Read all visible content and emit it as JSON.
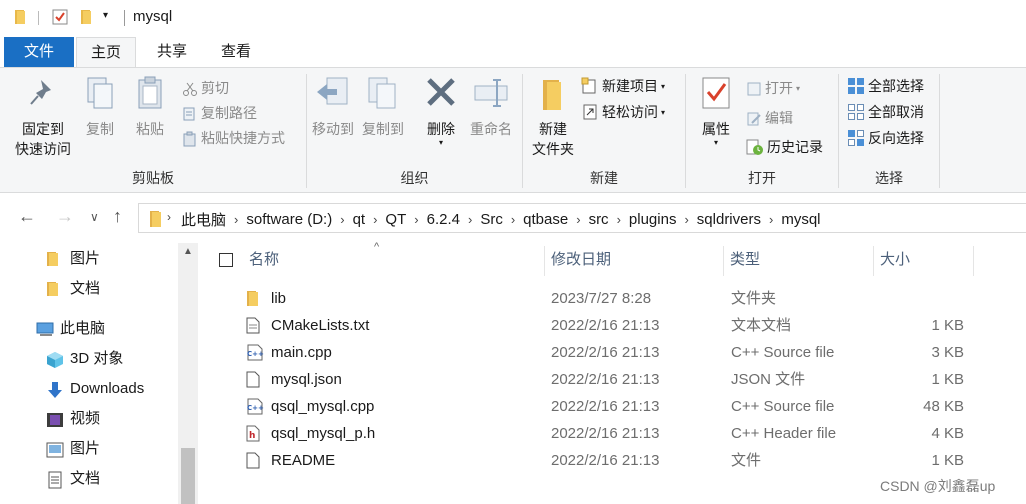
{
  "window": {
    "title": "mysql"
  },
  "tabs": {
    "file": "文件",
    "home": "主页",
    "share": "共享",
    "view": "查看"
  },
  "ribbon": {
    "clipboard": {
      "label": "剪贴板",
      "pin_line1": "固定到",
      "pin_line2": "快速访问",
      "copy": "复制",
      "paste": "粘贴",
      "cut": "剪切",
      "copy_path": "复制路径",
      "paste_shortcut": "粘贴快捷方式"
    },
    "organize": {
      "label": "组织",
      "move_to": "移动到",
      "copy_to": "复制到",
      "delete": "删除",
      "rename": "重命名"
    },
    "new": {
      "label": "新建",
      "new_folder_line1": "新建",
      "new_folder_line2": "文件夹",
      "new_item": "新建项目",
      "easy_access": "轻松访问"
    },
    "open": {
      "label": "打开",
      "properties": "属性",
      "open": "打开",
      "edit": "编辑",
      "history": "历史记录"
    },
    "select": {
      "label": "选择",
      "select_all": "全部选择",
      "select_none": "全部取消",
      "invert": "反向选择"
    }
  },
  "breadcrumbs": [
    "此电脑",
    "software (D:)",
    "qt",
    "QT",
    "6.2.4",
    "Src",
    "qtbase",
    "src",
    "plugins",
    "sqldrivers",
    "mysql"
  ],
  "sidebar": {
    "items": [
      {
        "label": "图片",
        "icon": "folder-icon"
      },
      {
        "label": "文档",
        "icon": "folder-icon"
      },
      {
        "label": "此电脑",
        "icon": "computer-icon"
      },
      {
        "label": "3D 对象",
        "icon": "3d-objects-icon"
      },
      {
        "label": "Downloads",
        "icon": "download-icon"
      },
      {
        "label": "视频",
        "icon": "video-icon"
      },
      {
        "label": "图片",
        "icon": "pictures-icon"
      },
      {
        "label": "文档",
        "icon": "documents-icon"
      }
    ]
  },
  "list": {
    "columns": {
      "name": "名称",
      "date": "修改日期",
      "type": "类型",
      "size": "大小"
    },
    "rows": [
      {
        "name": "lib",
        "date": "2023/7/27 8:28",
        "type": "文件夹",
        "size": "",
        "icon": "folder-icon"
      },
      {
        "name": "CMakeLists.txt",
        "date": "2022/2/16 21:13",
        "type": "文本文档",
        "size": "1 KB",
        "icon": "text-file-icon"
      },
      {
        "name": "main.cpp",
        "date": "2022/2/16 21:13",
        "type": "C++ Source file",
        "size": "3 KB",
        "icon": "cpp-file-icon"
      },
      {
        "name": "mysql.json",
        "date": "2022/2/16 21:13",
        "type": "JSON 文件",
        "size": "1 KB",
        "icon": "text-file-icon"
      },
      {
        "name": "qsql_mysql.cpp",
        "date": "2022/2/16 21:13",
        "type": "C++ Source file",
        "size": "48 KB",
        "icon": "cpp-file-icon"
      },
      {
        "name": "qsql_mysql_p.h",
        "date": "2022/2/16 21:13",
        "type": "C++ Header file",
        "size": "4 KB",
        "icon": "header-file-icon"
      },
      {
        "name": "README",
        "date": "2022/2/16 21:13",
        "type": "文件",
        "size": "1 KB",
        "icon": "text-file-icon"
      }
    ]
  },
  "watermark": "CSDN @刘鑫磊up"
}
